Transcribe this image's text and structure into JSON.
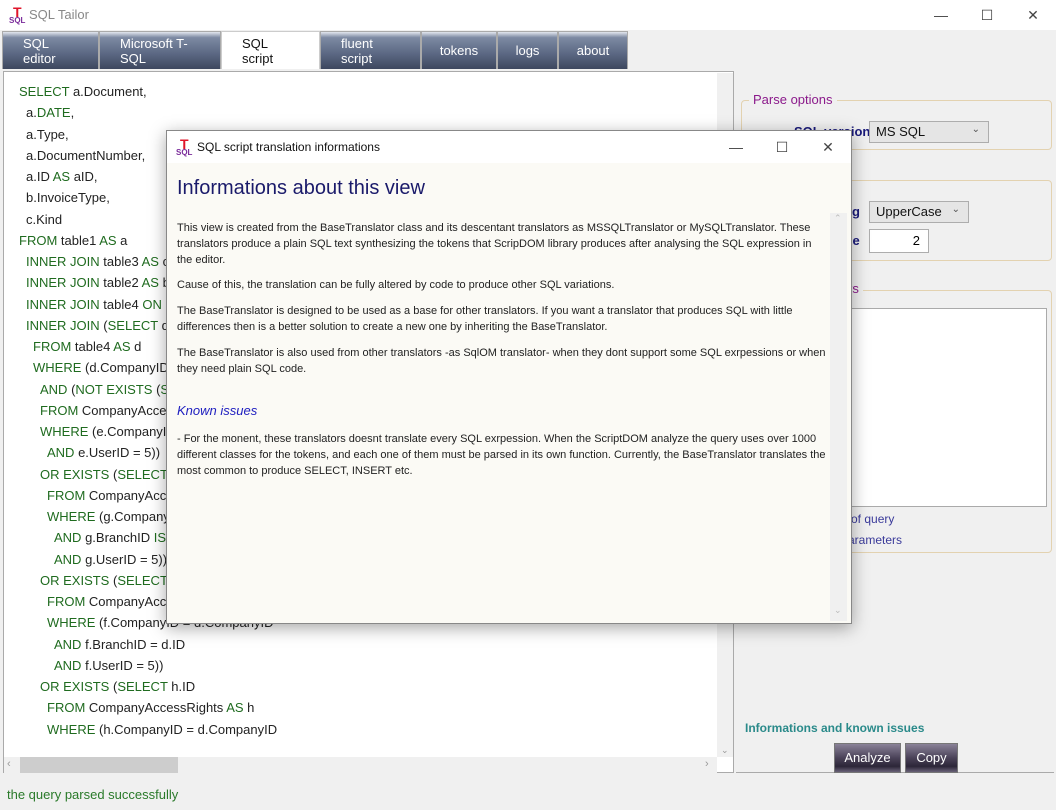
{
  "app": {
    "title": "SQL Tailor",
    "logo_text": "SQL",
    "logo_letter": "T"
  },
  "window_controls": {
    "minimize": "—",
    "maximize": "☐",
    "close": "✕"
  },
  "tabs": [
    {
      "label": "SQL editor"
    },
    {
      "label": "Microsoft T-SQL"
    },
    {
      "label": "SQL script",
      "active": true
    },
    {
      "label": "fluent script"
    },
    {
      "label": "tokens"
    },
    {
      "label": "logs"
    },
    {
      "label": "about"
    }
  ],
  "editor": {
    "lines": [
      {
        "indent": 0,
        "parts": [
          [
            "k",
            "SELECT"
          ],
          [
            "t",
            " a.Document,"
          ]
        ]
      },
      {
        "indent": 1,
        "parts": [
          [
            "t",
            "a."
          ],
          [
            "k",
            "DATE"
          ],
          [
            "t",
            ","
          ]
        ]
      },
      {
        "indent": 1,
        "parts": [
          [
            "t",
            "a.Type,"
          ]
        ]
      },
      {
        "indent": 1,
        "parts": [
          [
            "t",
            "a.DocumentNumber,"
          ]
        ]
      },
      {
        "indent": 1,
        "parts": [
          [
            "t",
            "a.ID "
          ],
          [
            "k",
            "AS"
          ],
          [
            "t",
            " aID,"
          ]
        ]
      },
      {
        "indent": 1,
        "parts": [
          [
            "t",
            "b.InvoiceType,"
          ]
        ]
      },
      {
        "indent": 1,
        "parts": [
          [
            "t",
            "c.Kind"
          ]
        ]
      },
      {
        "indent": 0,
        "parts": [
          [
            "k",
            "FROM"
          ],
          [
            "t",
            " table1 "
          ],
          [
            "k",
            "AS"
          ],
          [
            "t",
            " a"
          ]
        ]
      },
      {
        "indent": 1,
        "parts": [
          [
            "k",
            "INNER JOIN"
          ],
          [
            "t",
            " table3 "
          ],
          [
            "k",
            "AS"
          ],
          [
            "t",
            " c"
          ]
        ]
      },
      {
        "indent": 1,
        "parts": [
          [
            "k",
            "INNER JOIN"
          ],
          [
            "t",
            " table2 "
          ],
          [
            "k",
            "AS"
          ],
          [
            "t",
            " b"
          ]
        ]
      },
      {
        "indent": 1,
        "parts": [
          [
            "k",
            "INNER JOIN"
          ],
          [
            "t",
            " table4 "
          ],
          [
            "k",
            "ON"
          ],
          [
            "t",
            " ("
          ]
        ]
      },
      {
        "indent": 1,
        "parts": [
          [
            "k",
            "INNER JOIN"
          ],
          [
            "t",
            " ("
          ],
          [
            "k",
            "SELECT"
          ],
          [
            "t",
            " d.*"
          ]
        ]
      },
      {
        "indent": 2,
        "parts": [
          [
            "k",
            "FROM"
          ],
          [
            "t",
            " table4 "
          ],
          [
            "k",
            "AS"
          ],
          [
            "t",
            " d"
          ]
        ]
      },
      {
        "indent": 2,
        "parts": [
          [
            "k",
            "WHERE"
          ],
          [
            "t",
            " (d.CompanyID"
          ]
        ]
      },
      {
        "indent": 3,
        "parts": [
          [
            "k",
            "AND"
          ],
          [
            "t",
            " ("
          ],
          [
            "k",
            "NOT EXISTS"
          ],
          [
            "t",
            " ("
          ],
          [
            "k",
            "SE"
          ]
        ]
      },
      {
        "indent": 3,
        "parts": [
          [
            "k",
            "FROM"
          ],
          [
            "t",
            " CompanyAcces"
          ]
        ]
      },
      {
        "indent": 3,
        "parts": [
          [
            "k",
            "WHERE"
          ],
          [
            "t",
            " (e.CompanyID"
          ]
        ]
      },
      {
        "indent": 4,
        "parts": [
          [
            "k",
            "AND"
          ],
          [
            "t",
            " e.UserID = 5))"
          ]
        ]
      },
      {
        "indent": 3,
        "parts": [
          [
            "k",
            "OR EXISTS"
          ],
          [
            "t",
            " ("
          ],
          [
            "k",
            "SELECT"
          ],
          [
            "t",
            " g."
          ]
        ]
      },
      {
        "indent": 4,
        "parts": [
          [
            "k",
            "FROM"
          ],
          [
            "t",
            " CompanyAcce"
          ]
        ]
      },
      {
        "indent": 4,
        "parts": [
          [
            "k",
            "WHERE"
          ],
          [
            "t",
            " (g.Company"
          ]
        ]
      },
      {
        "indent": 5,
        "parts": [
          [
            "k",
            "AND"
          ],
          [
            "t",
            " g.BranchID "
          ],
          [
            "k",
            "IS"
          ]
        ]
      },
      {
        "indent": 5,
        "parts": [
          [
            "k",
            "AND"
          ],
          [
            "t",
            " g.UserID = 5))"
          ]
        ]
      },
      {
        "indent": 3,
        "parts": [
          [
            "k",
            "OR EXISTS"
          ],
          [
            "t",
            " ("
          ],
          [
            "k",
            "SELECT"
          ],
          [
            "t",
            " f.I"
          ]
        ]
      },
      {
        "indent": 4,
        "parts": [
          [
            "k",
            "FROM"
          ],
          [
            "t",
            " CompanyAcce"
          ]
        ]
      },
      {
        "indent": 4,
        "parts": [
          [
            "k",
            "WHERE"
          ],
          [
            "t",
            " (f.CompanyID = d.CompanyID"
          ]
        ]
      },
      {
        "indent": 5,
        "parts": [
          [
            "k",
            "AND"
          ],
          [
            "t",
            " f.BranchID = d.ID"
          ]
        ]
      },
      {
        "indent": 5,
        "parts": [
          [
            "k",
            "AND"
          ],
          [
            "t",
            " f.UserID = 5))"
          ]
        ]
      },
      {
        "indent": 3,
        "parts": [
          [
            "k",
            "OR EXISTS"
          ],
          [
            "t",
            " ("
          ],
          [
            "k",
            "SELECT"
          ],
          [
            "t",
            " h.ID"
          ]
        ]
      },
      {
        "indent": 4,
        "parts": [
          [
            "k",
            "FROM"
          ],
          [
            "t",
            " CompanyAccessRights "
          ],
          [
            "k",
            "AS"
          ],
          [
            "t",
            " h"
          ]
        ]
      },
      {
        "indent": 4,
        "parts": [
          [
            "k",
            "WHERE"
          ],
          [
            "t",
            " (h.CompanyID = d.CompanyID"
          ]
        ]
      }
    ]
  },
  "panel": {
    "parse_options": {
      "legend": "Parse options",
      "sql_version_label": "SQL version",
      "sql_version_value": "MS SQL"
    },
    "format": {
      "casing_label_visible": "ng",
      "casing_value": "UpperCase",
      "indent_label_visible": "ze",
      "indent_value": "2"
    },
    "params": {
      "legend_visible": "rs",
      "link1_visible": "of query",
      "link2_visible": "arameters"
    },
    "info_link": "Informations and known issues",
    "analyze_button": "Analyze",
    "copy_button": "Copy"
  },
  "status": "the query parsed successfully",
  "dialog": {
    "title": "SQL script translation informations",
    "heading": "Informations about this view",
    "paragraphs": [
      "This view is created from the BaseTranslator class and its descentant translators as MSSQLTranslator or MySQLTranslator. These translators produce a plain SQL text synthesizing the tokens that ScripDOM library produces after analysing the SQL expression in the editor.",
      "Cause of this, the translation can be fully altered by code to produce other SQL variations.",
      "The BaseTranslator is designed to be used as a base for other translators. If you want a translator that produces SQL with little differences then is a better solution to create a new one by inheriting the BaseTranslator.",
      "The BaseTranslator is also used from other translators -as SqlOM translator- when they dont support some SQL exrpessions or when they need plain SQL code."
    ],
    "known_issues_heading": "Known issues",
    "known_issues_text": "- For the monent, these translators doesnt translate every SQL exrpession. When the ScriptDOM analyze the query uses over 1000 different classes for the tokens, and each one of them must be parsed in its own function. Currently, the BaseTranslator translates the most common to produce SELECT, INSERT etc."
  },
  "colors": {
    "keyword": "#1f6b1f",
    "legend": "#8b1a8b",
    "status": "#2a7a2a",
    "info_link": "#2a8a8a",
    "dialog_heading": "#1a1a6a"
  }
}
